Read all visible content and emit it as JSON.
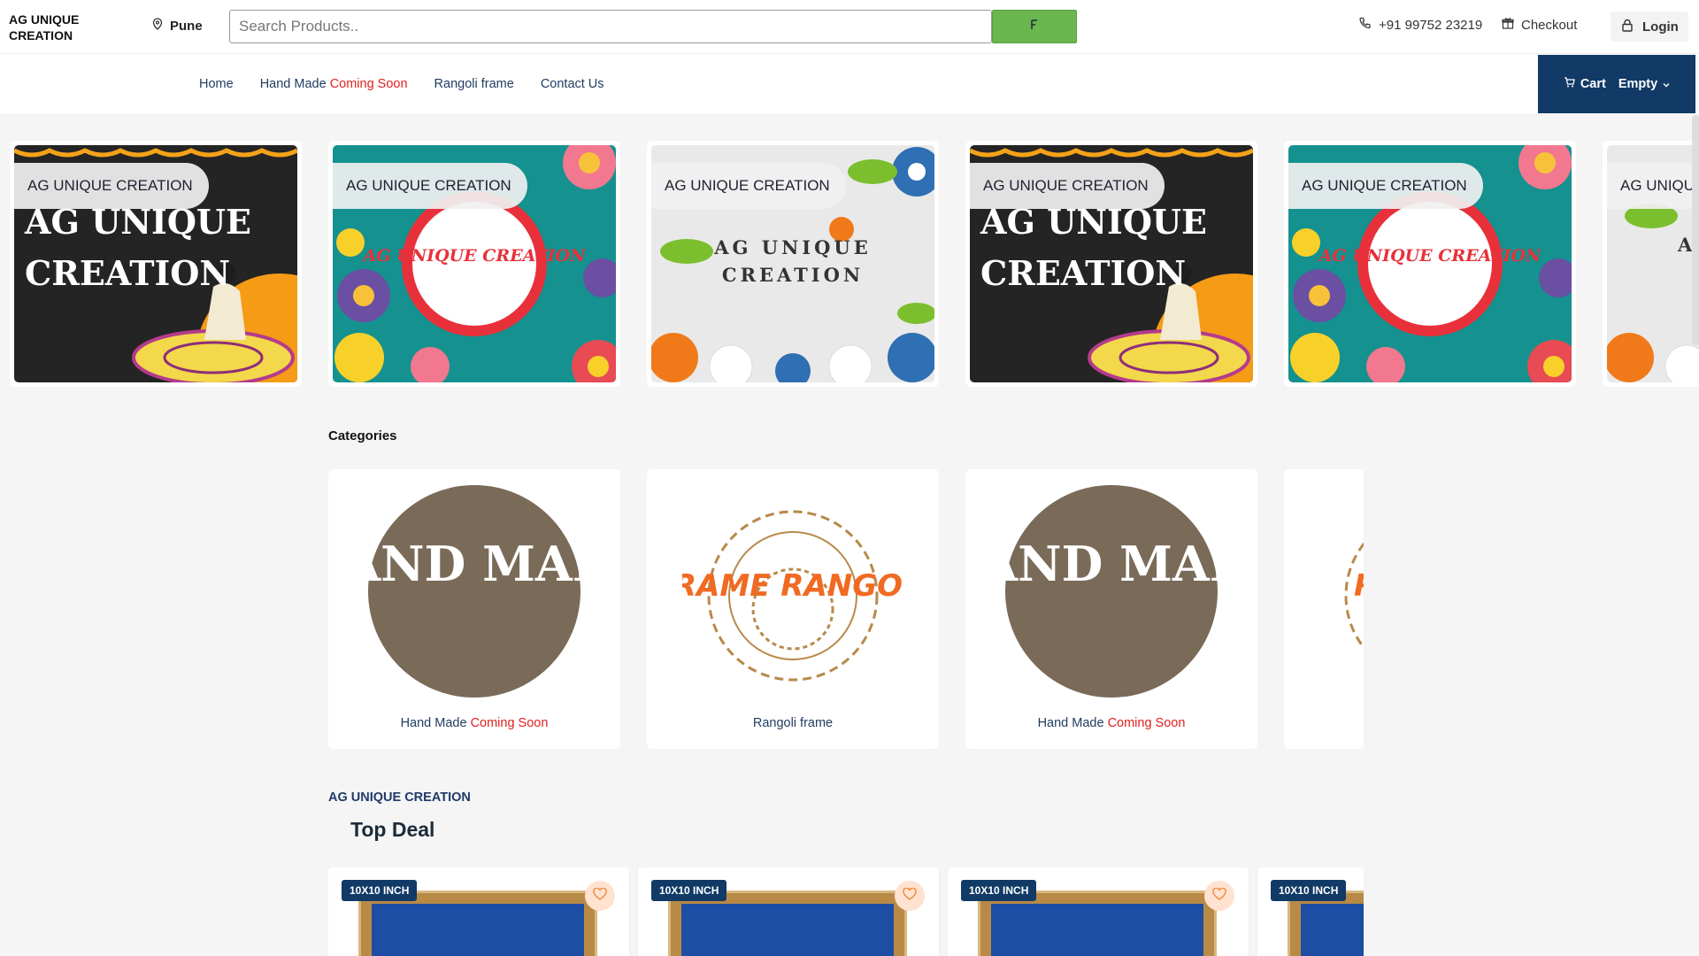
{
  "header": {
    "brand": "AG UNIQUE CREATION",
    "location": "Pune",
    "search_placeholder": "Search Products..",
    "phone": "+91 99752 23219",
    "checkout_label": "Checkout",
    "login_label": "Login"
  },
  "nav": {
    "home": "Home",
    "handmade": "Hand Made ",
    "handmade_badge": "Coming Soon",
    "rangoli": "Rangoli frame",
    "contact": "Contact Us",
    "cart_label": "Cart",
    "cart_status": "Empty"
  },
  "carousel": {
    "slides": [
      {
        "label": "AG UNIQUE CREATION",
        "art": "AG UNIQUE CREATION"
      },
      {
        "label": "AG UNIQUE CREATION",
        "art": "AG UNIQUE CREATION"
      },
      {
        "label": "AG UNIQUE CREATION",
        "art": "AG UNIQUE CREATION"
      },
      {
        "label": "AG UNIQUE CREATION",
        "art": "AG UNIQUE CREATION"
      },
      {
        "label": "AG UNIQUE CREATION",
        "art": "AG UNIQUE CREATION"
      },
      {
        "label": "AG UNIQUE",
        "art": "A"
      }
    ]
  },
  "categories": {
    "title": "Categories",
    "items": [
      {
        "name": "Hand Made ",
        "badge": "Coming Soon",
        "logo": "HAND MADE"
      },
      {
        "name": "Rangoli frame",
        "badge": "",
        "logo": "FRAME RANGOLI"
      },
      {
        "name": "Hand Made ",
        "badge": "Coming Soon",
        "logo": "HAND MADE"
      },
      {
        "name": "",
        "badge": "",
        "logo": "RANGOLI"
      }
    ]
  },
  "deals": {
    "brand": "AG UNIQUE CREATION",
    "title": "Top Deal",
    "products": [
      {
        "badge": "10X10 INCH"
      },
      {
        "badge": "10X10 INCH"
      },
      {
        "badge": "10X10 INCH"
      },
      {
        "badge": "10X10 INCH"
      }
    ]
  },
  "colors": {
    "primary": "#113a66",
    "accent_green": "#6ab64f",
    "coming_soon_red": "#e02020"
  }
}
